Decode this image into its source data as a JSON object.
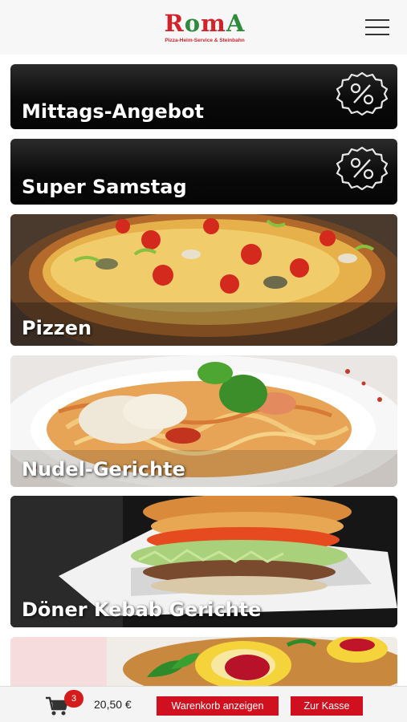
{
  "header": {
    "logo_text": [
      "R",
      "o",
      "m",
      "A"
    ],
    "logo_subtitle": "Pizza-Heim-Service & Steinbahn"
  },
  "categories": [
    {
      "label": "Mittags-Angebot",
      "icon": "percent-badge-icon"
    },
    {
      "label": "Super Samstag",
      "icon": "percent-badge-icon"
    },
    {
      "label": "Pizzen",
      "image": "pizza"
    },
    {
      "label": "Nudel-Gerichte",
      "image": "spaghetti"
    },
    {
      "label": "Döner Kebab Gerichte",
      "image": "doener"
    },
    {
      "label": "",
      "image": "schnitzel"
    }
  ],
  "cart": {
    "count": "3",
    "total": "20,50 €",
    "show_cart_label": "Warenkorb anzeigen",
    "checkout_label": "Zur Kasse"
  },
  "colors": {
    "brand_red": "#d0101e",
    "brand_green": "#2e8b3d",
    "card_dark": "#0a0a0a"
  }
}
